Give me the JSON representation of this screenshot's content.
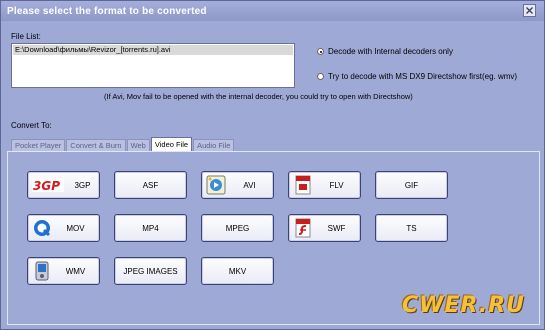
{
  "window": {
    "title": "Please select the format to be converted"
  },
  "file_list": {
    "label": "File List:",
    "items": [
      "E:\\Download\\фильмы\\Revizor_[torrents.ru].avi"
    ]
  },
  "decode_options": {
    "internal": "Decode with Internal decoders only",
    "directshow": "Try to decode with MS DX9 Directshow first(eg. wmv)",
    "selected": "internal"
  },
  "note": "(If Avi, Mov fail to be opened with the internal decoder, you could try to open with Directshow)",
  "convert_to": {
    "label": "Convert To:",
    "tabs": [
      "Pocket Player",
      "Convert & Burn",
      "Web",
      "Video File",
      "Audio File"
    ],
    "active_tab": "Video File"
  },
  "formats": [
    {
      "label": "3GP",
      "icon": "3gp-logo-icon"
    },
    {
      "label": "ASF",
      "icon": ""
    },
    {
      "label": "AVI",
      "icon": "avi-film-icon"
    },
    {
      "label": "FLV",
      "icon": "flv-document-icon"
    },
    {
      "label": "GIF",
      "icon": ""
    },
    {
      "label": "MOV",
      "icon": "quicktime-icon"
    },
    {
      "label": "MP4",
      "icon": ""
    },
    {
      "label": "MPEG",
      "icon": ""
    },
    {
      "label": "SWF",
      "icon": "flash-icon"
    },
    {
      "label": "TS",
      "icon": ""
    },
    {
      "label": "WMV",
      "icon": "wmv-device-icon"
    },
    {
      "label": "JPEG IMAGES",
      "icon": ""
    },
    {
      "label": "MKV",
      "icon": ""
    }
  ],
  "branding": {
    "watermark": "CWER.RU"
  }
}
